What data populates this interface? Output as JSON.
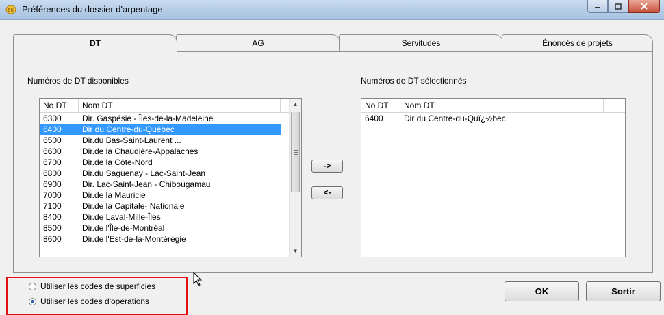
{
  "window": {
    "title": "Préférences du dossier d'arpentage"
  },
  "tabs": [
    {
      "label": "DT",
      "active": true
    },
    {
      "label": "AG",
      "active": false
    },
    {
      "label": "Servitudes",
      "active": false
    },
    {
      "label": "Énoncés de projets",
      "active": false
    }
  ],
  "available": {
    "heading": "Numéros de DT disponibles",
    "columns": [
      "No DT",
      "Nom DT"
    ],
    "rows": [
      {
        "no": "6300",
        "nom": "Dir. Gaspésie - Îles-de-la-Madeleine"
      },
      {
        "no": "6400",
        "nom": "Dir du Centre-du-Québec"
      },
      {
        "no": "6500",
        "nom": "Dir.du Bas-Saint-Laurent  ..."
      },
      {
        "no": "6600",
        "nom": "Dir.de la Chaudière-Appalaches"
      },
      {
        "no": "6700",
        "nom": "Dir.de la Côte-Nord"
      },
      {
        "no": "6800",
        "nom": "Dir.du Saguenay - Lac-Saint-Jean"
      },
      {
        "no": "6900",
        "nom": "Dir. Lac-Saint-Jean - Chibougamau"
      },
      {
        "no": "7000",
        "nom": "Dir.de la Mauricie"
      },
      {
        "no": "7100",
        "nom": "Dir.de la Capitale- Nationale"
      },
      {
        "no": "8400",
        "nom": "Dir.de Laval-Mille-Îles"
      },
      {
        "no": "8500",
        "nom": "Dir.de l'Île-de-Montréal"
      },
      {
        "no": "8600",
        "nom": "Dir.de l'Est-de-la-Montérégie"
      }
    ],
    "selected_index": 1
  },
  "selected": {
    "heading": "Numéros de DT sélectionnés",
    "columns": [
      "No DT",
      "Nom DT"
    ],
    "rows": [
      {
        "no": "6400",
        "nom": "Dir du Centre-du-Quï¿½bec"
      }
    ]
  },
  "buttons": {
    "add": "->",
    "remove": "<-",
    "ok": "OK",
    "exit": "Sortir"
  },
  "options": [
    {
      "label": "Utiliser les codes de superficies",
      "checked": false
    },
    {
      "label": "Utiliser les codes d'opérations",
      "checked": true
    }
  ]
}
